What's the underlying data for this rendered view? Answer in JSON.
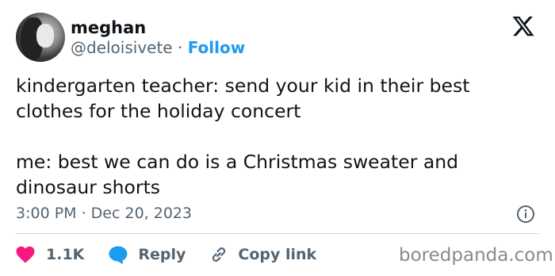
{
  "author": {
    "name": "meghan",
    "handle": "@deloisivete",
    "separator": "·",
    "follow_label": "Follow"
  },
  "tweet": {
    "lines_paragraph_1": [
      "kindergarten teacher: send your kid in their best",
      "clothes for the holiday concert"
    ],
    "lines_paragraph_2": [
      "me: best we can do is a Christmas sweater and",
      "dinosaur shorts"
    ],
    "timestamp": "3:00 PM · Dec 20, 2023"
  },
  "actions": {
    "likes_count": "1.1K",
    "reply_label": "Reply",
    "copy_link_label": "Copy link"
  },
  "icons": {
    "logo": "x-logo-icon",
    "info": "info-icon",
    "like": "heart-icon",
    "reply": "speech-bubble-icon",
    "copy": "link-icon"
  },
  "colors": {
    "accent": "#1d9bf0",
    "heart": "#f91880",
    "secondary_text": "#536471",
    "divider": "#cfd9de"
  },
  "watermark": "boredpanda.com"
}
